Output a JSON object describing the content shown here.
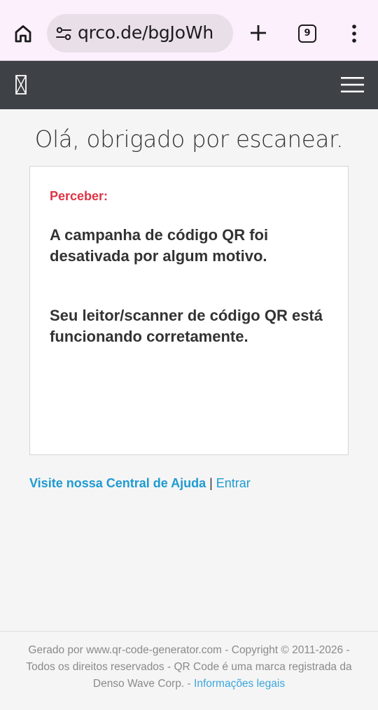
{
  "browser": {
    "url": "qrco.de/bgJoWh",
    "tab_count": "9"
  },
  "header": {
    "logo_icon": "qr-logo-icon",
    "menu_icon": "hamburger-icon"
  },
  "main": {
    "title": "Olá, obrigado por escanear.",
    "notice": {
      "label": "Perceber:",
      "message": "A campanha de código QR foi desativada por algum motivo.",
      "status": "Seu leitor/scanner de código QR está funcionando corretamente."
    },
    "links": {
      "help": "Visite nossa Central de Ajuda",
      "separator": " | ",
      "login": "Entrar"
    }
  },
  "footer": {
    "text": "Gerado por www.qr-code-generator.com - Copyright © 2011-2026 - Todos os direitos reservados - QR Code é uma marca registrada da Denso Wave Corp. - ",
    "legal_link": "Informações legais"
  },
  "colors": {
    "chrome_bg": "#fbf0fb",
    "header_bg": "#3e4146",
    "notice_label": "#dc3545",
    "link": "#1d9bd1"
  }
}
